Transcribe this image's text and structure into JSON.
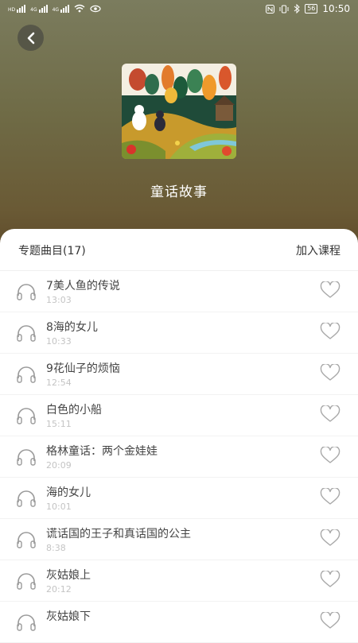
{
  "status_bar": {
    "left": [
      "HD",
      "4G",
      "4G"
    ],
    "battery": "56",
    "time": "10:50"
  },
  "album": {
    "title": "童话故事"
  },
  "list_header": {
    "section_title": "专题曲目(17)",
    "join_label": "加入课程"
  },
  "tracks": [
    {
      "title": "7美人鱼的传说",
      "duration": "13:03"
    },
    {
      "title": "8海的女儿",
      "duration": "10:33"
    },
    {
      "title": "9花仙子的烦恼",
      "duration": "12:54"
    },
    {
      "title": "白色的小船",
      "duration": "15:11"
    },
    {
      "title": "格林童话：两个金娃娃",
      "duration": "20:09"
    },
    {
      "title": "海的女儿",
      "duration": "10:01"
    },
    {
      "title": "谎话国的王子和真话国的公主",
      "duration": "8:38"
    },
    {
      "title": "灰姑娘上",
      "duration": "20:12"
    },
    {
      "title": "灰姑娘下",
      "duration": ""
    }
  ],
  "icons": {
    "back": "chevron-left-icon",
    "track": "headphones-icon",
    "favorite": "heart-outline-icon"
  },
  "colors": {
    "header_gradient_top": "#7b7c5e",
    "header_gradient_bottom": "#5e4a2a",
    "sheet": "#ffffff",
    "duration_text": "#c4c4c4",
    "icon_gray": "#9a9a9a"
  }
}
